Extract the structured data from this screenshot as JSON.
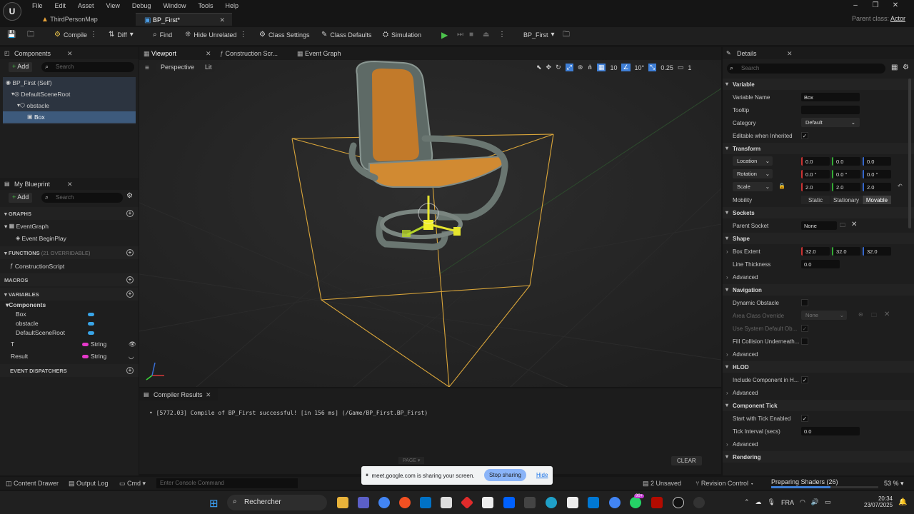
{
  "menu": [
    "File",
    "Edit",
    "Asset",
    "View",
    "Debug",
    "Window",
    "Tools",
    "Help"
  ],
  "logo": "U",
  "window_controls": {
    "minimize": "–",
    "restore": "❐",
    "close": "✕"
  },
  "tabs": [
    {
      "label": "ThirdPersonMap"
    },
    {
      "label": "BP_First*"
    }
  ],
  "parent_class": {
    "label": "Parent class:",
    "value": "Actor"
  },
  "toolbar": {
    "compile": "Compile",
    "diff": "Diff",
    "find": "Find",
    "hide_unrelated": "Hide Unrelated",
    "class_settings": "Class Settings",
    "class_defaults": "Class Defaults",
    "simulation": "Simulation",
    "debug_object": "BP_First"
  },
  "components_panel": {
    "title": "Components",
    "add": "Add",
    "search_placeholder": "Search",
    "tree": [
      {
        "label": "BP_First (Self)",
        "indent": 0
      },
      {
        "label": "DefaultSceneRoot",
        "indent": 1
      },
      {
        "label": "obstacle",
        "indent": 2
      },
      {
        "label": "Box",
        "indent": 3,
        "selected": true
      }
    ]
  },
  "my_blueprint": {
    "title": "My Blueprint",
    "add": "Add",
    "search_placeholder": "Search",
    "graphs_label": "GRAPHS",
    "event_graph": "EventGraph",
    "event_begin_play": "Event BeginPlay",
    "functions_label": "FUNCTIONS",
    "functions_count": "(21 OVERRIDABLE)",
    "construction_script": "ConstructionScript",
    "macros_label": "MACROS",
    "variables_label": "VARIABLES",
    "components_label": "Components",
    "component_vars": [
      "Box",
      "obstacle",
      "DefaultSceneRoot"
    ],
    "vars": [
      {
        "name": "T",
        "type": "String"
      },
      {
        "name": "Result",
        "type": "String"
      }
    ],
    "dispatchers_label": "EVENT DISPATCHERS"
  },
  "viewport_tabs": [
    "Viewport",
    "Construction Scr...",
    "Event Graph"
  ],
  "viewport": {
    "perspective": "Perspective",
    "lit": "Lit",
    "grid": "10",
    "angle": "10°",
    "scale": "0.25",
    "cam": "1"
  },
  "compiler": {
    "title": "Compiler Results",
    "message": "[5772.03] Compile of BP_First successful! [in 156 ms] (/Game/BP_First.BP_First)",
    "page": "PAGE",
    "clear": "CLEAR"
  },
  "details": {
    "title": "Details",
    "search_placeholder": "Search",
    "variable_header": "Variable",
    "variable_name_label": "Variable Name",
    "variable_name": "Box",
    "tooltip_label": "Tooltip",
    "category_label": "Category",
    "category": "Default",
    "editable_label": "Editable when Inherited",
    "transform_header": "Transform",
    "location": "Location",
    "rotation": "Rotation",
    "scale": "Scale",
    "loc": [
      "0.0",
      "0.0",
      "0.0"
    ],
    "rot": [
      "0.0 °",
      "0.0 °",
      "0.0 °"
    ],
    "scl": [
      "2.0",
      "2.0",
      "2.0"
    ],
    "mobility_label": "Mobility",
    "mobility": [
      "Static",
      "Stationary",
      "Movable"
    ],
    "sockets_header": "Sockets",
    "parent_socket_label": "Parent Socket",
    "parent_socket": "None",
    "shape_header": "Shape",
    "box_extent_label": "Box Extent",
    "box_extent": [
      "32.0",
      "32.0",
      "32.0"
    ],
    "line_thickness_label": "Line Thickness",
    "line_thickness": "0.0",
    "advanced": "Advanced",
    "navigation_header": "Navigation",
    "dynamic_obstacle": "Dynamic Obstacle",
    "area_class_override": "Area Class Override",
    "area_class_value": "None",
    "use_system_default": "Use System Default Ob...",
    "fill_collision": "Fill Collision Underneath...",
    "hlod_header": "HLOD",
    "include_component": "Include Component in H...",
    "tick_header": "Component Tick",
    "start_tick": "Start with Tick Enabled",
    "tick_interval_label": "Tick Interval (secs)",
    "tick_interval": "0.0",
    "rendering_header": "Rendering"
  },
  "statusbar": {
    "content_drawer": "Content Drawer",
    "output_log": "Output Log",
    "cmd": "Cmd",
    "console_placeholder": "Enter Console Command",
    "unsaved": "2 Unsaved",
    "revision_control": "Revision Control",
    "shaders": "Preparing Shaders (26)",
    "shader_percent": "53 %",
    "shader_progress": 0.55
  },
  "share_bar": {
    "text": "meet.google.com is sharing your screen.",
    "stop": "Stop sharing",
    "hide": "Hide"
  },
  "taskbar": {
    "search": "Rechercher",
    "lang": "FRA",
    "time": "20:34",
    "date": "23/07/2025",
    "badge": "99+"
  },
  "colors": {
    "accent": "#3f7fd6",
    "selection": "#2f4b6c",
    "box_outline": "#d9a53a",
    "seat": "#d18a32"
  }
}
